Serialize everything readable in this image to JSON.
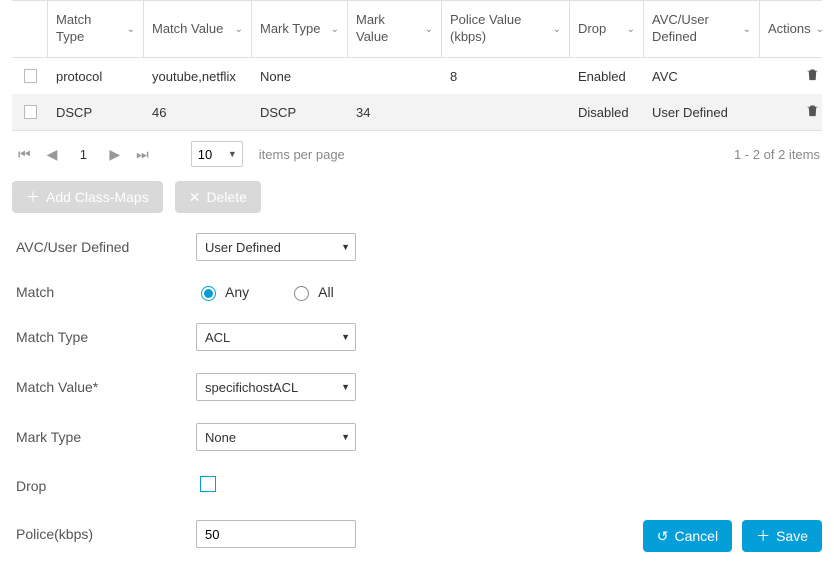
{
  "table": {
    "headers": {
      "match_type": "Match Type",
      "match_value": "Match Value",
      "mark_type": "Mark Type",
      "mark_value": "Mark Value",
      "police_value": "Police Value (kbps)",
      "drop": "Drop",
      "avc": "AVC/User Defined",
      "actions": "Actions"
    },
    "rows": [
      {
        "match_type": "protocol",
        "match_value": "youtube,netflix",
        "mark_type": "None",
        "mark_value": "",
        "police_value": "8",
        "drop": "Enabled",
        "avc": "AVC"
      },
      {
        "match_type": "DSCP",
        "match_value": "46",
        "mark_type": "DSCP",
        "mark_value": "34",
        "police_value": "",
        "drop": "Disabled",
        "avc": "User Defined"
      }
    ]
  },
  "pager": {
    "page": "1",
    "page_size": "10",
    "items_per_page": "items per page",
    "summary": "1 - 2 of 2 items"
  },
  "buttons": {
    "add_classmaps": "Add Class-Maps",
    "delete": "Delete",
    "cancel": "Cancel",
    "save": "Save"
  },
  "form": {
    "labels": {
      "avc": "AVC/User Defined",
      "match": "Match",
      "match_type": "Match Type",
      "match_value": "Match Value*",
      "mark_type": "Mark Type",
      "drop": "Drop",
      "police": "Police(kbps)"
    },
    "values": {
      "avc": "User Defined",
      "radio_any": "Any",
      "radio_all": "All",
      "match_type": "ACL",
      "match_value": "specifichostACL",
      "mark_type": "None",
      "police": "50"
    }
  }
}
